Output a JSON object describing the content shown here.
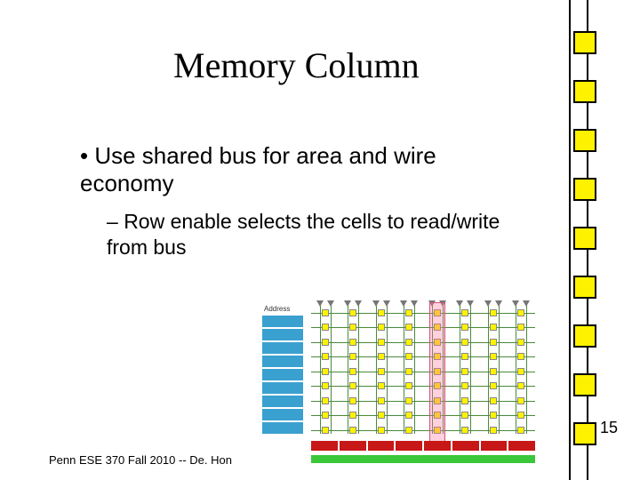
{
  "title": "Memory Column",
  "bullet_main": "Use shared bus for area and wire economy",
  "sub_bullet": "Row enable selects the cells to read/write from bus",
  "footer": "Penn ESE 370 Fall 2010 -- De. Hon",
  "page_number": "15",
  "decoder_label": "Address",
  "column_cells": [
    35,
    90,
    145,
    200,
    255,
    310,
    365,
    420,
    475
  ],
  "grid": {
    "rows": 9,
    "cols": 8,
    "highlight_col": 4
  }
}
